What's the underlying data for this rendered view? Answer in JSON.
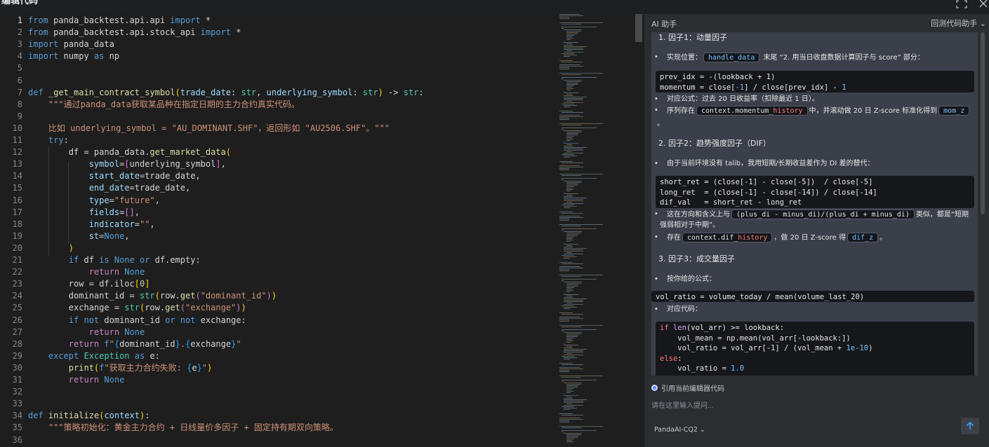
{
  "window": {
    "title": "编辑代码"
  },
  "editor": {
    "active_line": 1,
    "lines": [
      [
        [
          "k",
          "from"
        ],
        [
          "w",
          " panda_backtest.api.api "
        ],
        [
          "k",
          "import"
        ],
        [
          "w",
          " *"
        ]
      ],
      [
        [
          "k",
          "from"
        ],
        [
          "w",
          " panda_backtest.api.stock_api "
        ],
        [
          "k",
          "import"
        ],
        [
          "w",
          " *"
        ]
      ],
      [
        [
          "k",
          "import"
        ],
        [
          "w",
          " panda_data"
        ]
      ],
      [
        [
          "k",
          "import"
        ],
        [
          "w",
          " numpy "
        ],
        [
          "k",
          "as"
        ],
        [
          "w",
          " np"
        ]
      ],
      [],
      [],
      [
        [
          "k",
          "def"
        ],
        [
          "w",
          " "
        ],
        [
          "f",
          "_get_main_contract_symbol"
        ],
        [
          "p1",
          "("
        ],
        [
          "v",
          "trade_date"
        ],
        [
          "w",
          ": "
        ],
        [
          "t",
          "str"
        ],
        [
          "w",
          ", "
        ],
        [
          "v",
          "underlying_symbol"
        ],
        [
          "w",
          ": "
        ],
        [
          "t",
          "str"
        ],
        [
          "p1",
          ")"
        ],
        [
          "w",
          " -> "
        ],
        [
          "t",
          "str"
        ],
        [
          "w",
          ":"
        ]
      ],
      [
        [
          "w",
          "    "
        ],
        [
          "s",
          "\"\"\"通过panda_data获取某品种在指定日期的主力合约真实代码。"
        ]
      ],
      [],
      [
        [
          "s",
          "    比如 underlying_symbol = \"AU_DOMINANT.SHF\"，返回形如 \"AU2506.SHF\"。\"\"\""
        ]
      ],
      [
        [
          "w",
          "    "
        ],
        [
          "k",
          "try"
        ],
        [
          "w",
          ":"
        ]
      ],
      [
        [
          "w",
          "        df = panda_data."
        ],
        [
          "f",
          "get_market_data"
        ],
        [
          "p1",
          "("
        ]
      ],
      [
        [
          "w",
          "            "
        ],
        [
          "v",
          "symbol"
        ],
        [
          "w",
          "="
        ],
        [
          "p2",
          "["
        ],
        [
          "w",
          "underlying_symbol"
        ],
        [
          "p2",
          "]"
        ],
        [
          "w",
          ","
        ]
      ],
      [
        [
          "w",
          "            "
        ],
        [
          "v",
          "start_date"
        ],
        [
          "w",
          "=trade_date,"
        ]
      ],
      [
        [
          "w",
          "            "
        ],
        [
          "v",
          "end_date"
        ],
        [
          "w",
          "=trade_date,"
        ]
      ],
      [
        [
          "w",
          "            "
        ],
        [
          "v",
          "type"
        ],
        [
          "w",
          "="
        ],
        [
          "s",
          "\"future\""
        ],
        [
          "w",
          ","
        ]
      ],
      [
        [
          "w",
          "            "
        ],
        [
          "v",
          "fields"
        ],
        [
          "w",
          "="
        ],
        [
          "p2",
          "[]"
        ],
        [
          "w",
          ","
        ]
      ],
      [
        [
          "w",
          "            "
        ],
        [
          "v",
          "indicator"
        ],
        [
          "w",
          "="
        ],
        [
          "s",
          "\"\""
        ],
        [
          "w",
          ","
        ]
      ],
      [
        [
          "w",
          "            "
        ],
        [
          "v",
          "st"
        ],
        [
          "w",
          "="
        ],
        [
          "k",
          "None"
        ],
        [
          "w",
          ","
        ]
      ],
      [
        [
          "w",
          "        "
        ],
        [
          "p1",
          ")"
        ]
      ],
      [
        [
          "w",
          "        "
        ],
        [
          "k",
          "if"
        ],
        [
          "w",
          " df "
        ],
        [
          "k",
          "is"
        ],
        [
          "w",
          " "
        ],
        [
          "k",
          "None"
        ],
        [
          "w",
          " "
        ],
        [
          "k",
          "or"
        ],
        [
          "w",
          " df.empty:"
        ]
      ],
      [
        [
          "w",
          "            "
        ],
        [
          "kc",
          "return"
        ],
        [
          "w",
          " "
        ],
        [
          "k",
          "None"
        ]
      ],
      [
        [
          "w",
          "        row = df.iloc"
        ],
        [
          "p1",
          "["
        ],
        [
          "n",
          "0"
        ],
        [
          "p1",
          "]"
        ]
      ],
      [
        [
          "w",
          "        dominant_id = "
        ],
        [
          "t",
          "str"
        ],
        [
          "p1",
          "("
        ],
        [
          "w",
          "row."
        ],
        [
          "f",
          "get"
        ],
        [
          "p2",
          "("
        ],
        [
          "s",
          "\"dominant_id\""
        ],
        [
          "p2",
          ")"
        ],
        [
          "p1",
          ")"
        ]
      ],
      [
        [
          "w",
          "        exchange = "
        ],
        [
          "t",
          "str"
        ],
        [
          "p1",
          "("
        ],
        [
          "w",
          "row."
        ],
        [
          "f",
          "get"
        ],
        [
          "p2",
          "("
        ],
        [
          "s",
          "\"exchange\""
        ],
        [
          "p2",
          ")"
        ],
        [
          "p1",
          ")"
        ]
      ],
      [
        [
          "w",
          "        "
        ],
        [
          "k",
          "if"
        ],
        [
          "w",
          " "
        ],
        [
          "k",
          "not"
        ],
        [
          "w",
          " dominant_id "
        ],
        [
          "k",
          "or"
        ],
        [
          "w",
          " "
        ],
        [
          "k",
          "not"
        ],
        [
          "w",
          " exchange:"
        ]
      ],
      [
        [
          "w",
          "            "
        ],
        [
          "kc",
          "return"
        ],
        [
          "w",
          " "
        ],
        [
          "k",
          "None"
        ]
      ],
      [
        [
          "w",
          "        "
        ],
        [
          "kc",
          "return"
        ],
        [
          "w",
          " "
        ],
        [
          "k",
          "f"
        ],
        [
          "s",
          "\""
        ],
        [
          "p3",
          "{"
        ],
        [
          "w",
          "dominant_id"
        ],
        [
          "p3",
          "}"
        ],
        [
          "s",
          "."
        ],
        [
          "p3",
          "{"
        ],
        [
          "w",
          "exchange"
        ],
        [
          "p3",
          "}"
        ],
        [
          "s",
          "\""
        ]
      ],
      [
        [
          "w",
          "    "
        ],
        [
          "k",
          "except"
        ],
        [
          "w",
          " "
        ],
        [
          "t",
          "Exception"
        ],
        [
          "w",
          " "
        ],
        [
          "k",
          "as"
        ],
        [
          "w",
          " e:"
        ]
      ],
      [
        [
          "w",
          "        "
        ],
        [
          "f",
          "print"
        ],
        [
          "p1",
          "("
        ],
        [
          "k",
          "f"
        ],
        [
          "s",
          "\"获取主力合约失败: "
        ],
        [
          "p3",
          "{"
        ],
        [
          "w",
          "e"
        ],
        [
          "p3",
          "}"
        ],
        [
          "s",
          "\""
        ],
        [
          "p1",
          ")"
        ]
      ],
      [
        [
          "w",
          "        "
        ],
        [
          "kc",
          "return"
        ],
        [
          "w",
          " "
        ],
        [
          "k",
          "None"
        ]
      ],
      [],
      [],
      [
        [
          "k",
          "def"
        ],
        [
          "w",
          " "
        ],
        [
          "f",
          "initialize"
        ],
        [
          "p1",
          "("
        ],
        [
          "v",
          "context"
        ],
        [
          "p1",
          ")"
        ],
        [
          "w",
          ":"
        ]
      ],
      [
        [
          "w",
          "    "
        ],
        [
          "s",
          "\"\"\"策略初始化：黄金主力合约 + 日线量价多因子 + 固定持有期双向策略。"
        ]
      ],
      []
    ]
  },
  "ai": {
    "title": "AI 助手",
    "mode": "回测代码助手 ⌄",
    "factor1_heading": "1. 因子1：动量因子",
    "f1_b1_prefix": "实现位置：",
    "f1_b1_code": "handle_data",
    "f1_b1_suffix": " 末尾 “2. 用当日收盘数据计算因子与 score” 部分：",
    "f1_code_l1": "prev_idx = -(lookback + 1)",
    "f1_code_l2a": "momentum = close[",
    "f1_code_l2b": "-1",
    "f1_code_l2c": "] / close[prev_idx] - ",
    "f1_code_l2d": "1",
    "f1_b2": "对应公式：过去 20 日收益率（扣除最近 1 日）。",
    "f1_b3_prefix": "序列存在",
    "f1_b3_code_a": "context.momentum_",
    "f1_b3_code_b": "history",
    "f1_b3_mid": "中，并滚动做 20 日 Z-score 标准化得到",
    "f1_b3_code2": "mom_z",
    "f1_b3_end": "。",
    "factor2_heading": "2. 因子2：趋势强度因子（DIF）",
    "f2_b1": "由于当前环境没有 talib，我用短期/长期收益差作为 DI 差的替代：",
    "f2_code_l1": "short_ret = (close[-1] - close[-5])  / close[-5]",
    "f2_code_l2": "long_ret  = (close[-1] - close[-14]) / close[-14]",
    "f2_code_l3": "dif_val   = short_ret - long_ret",
    "f2_b2_prefix": "这在方向和含义上与",
    "f2_b2_code": "(plus_di - minus_di)/(plus_di + minus_di)",
    "f2_b2_suffix": "类似，都是“短期",
    "f2_b2_line2": "强弱相对于中期”。",
    "f2_b3_prefix": "存在",
    "f2_b3_code_a": "context.dif_",
    "f2_b3_code_b": "history",
    "f2_b3_mid": "，做 20 日 Z-score 得",
    "f2_b3_code2": "dif_z",
    "f2_b3_end": "。",
    "factor3_heading": "3. 因子3：成交量因子",
    "f3_b1": "按你给的公式：",
    "f3_formula": "vol_ratio = volume_today / mean(volume_last_20)",
    "f3_b2": "对应代码：",
    "f3_code_l1a": "if",
    "f3_code_l1b": " ",
    "f3_code_l1c": "len",
    "f3_code_l1d": "(vol_arr) >= lookback:",
    "f3_code_l2": "    vol_mean = np.mean(vol_arr[-lookback:])",
    "f3_code_l3a": "    vol_ratio = vol_arr[-1] / (vol_mean + ",
    "f3_code_l3b": "1e-10",
    "f3_code_l3c": ")",
    "f3_code_l4": "else",
    "f3_code_l4b": ":",
    "f3_code_l5a": "    vol_ratio = ",
    "f3_code_l5b": "1.0",
    "cite_label": "引用当前编辑器代码",
    "input_placeholder": "请在这里输入提问...",
    "model": "PandaAI-CQ2 ⌄"
  },
  "colors": {
    "editor_bg": "#1e1e1e",
    "panel_bg": "#2b2d31",
    "answer_bg": "#3a3f4a",
    "accent": "#5b8df5"
  }
}
